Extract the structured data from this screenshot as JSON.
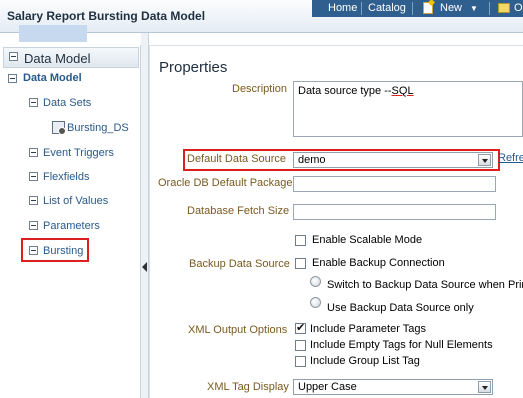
{
  "app": {
    "title": "Salary Report Bursting Data Model"
  },
  "nav": {
    "home": "Home",
    "catalog": "Catalog",
    "new": "New",
    "next_cut": "O"
  },
  "left_panel": {
    "header": "Data Model",
    "items": {
      "data_model": "Data Model",
      "data_sets": "Data Sets",
      "bursting_ds": "Bursting_DS",
      "event_triggers": "Event Triggers",
      "flexfields": "Flexfields",
      "list_of_values": "List of Values",
      "parameters": "Parameters",
      "bursting": "Bursting"
    }
  },
  "properties": {
    "title": "Properties",
    "description_label": "Description",
    "description_value_prefix": "Data source type --",
    "description_value_sql": "SQL",
    "default_data_source_label": "Default Data Source",
    "default_data_source_value": "demo",
    "refresh_link": "Refre",
    "oracle_db_default_package_label": "Oracle DB Default Package",
    "oracle_db_default_package_value": "",
    "database_fetch_size_label": "Database Fetch Size",
    "database_fetch_size_value": "",
    "enable_scalable_mode": {
      "label": "Enable Scalable Mode",
      "checked": false
    },
    "backup_data_source_label": "Backup Data Source",
    "enable_backup_connection": {
      "label": "Enable Backup Connection",
      "checked": false
    },
    "switch_backup_option": "Switch to Backup Data Source when Prim",
    "use_backup_only_option": "Use Backup Data Source only",
    "xml_output_options_label": "XML Output Options",
    "include_parameter_tags": {
      "label": "Include Parameter Tags",
      "checked": true
    },
    "include_empty_tags": {
      "label": "Include Empty Tags for Null Elements",
      "checked": false
    },
    "include_group_list_tag": {
      "label": "Include Group List Tag",
      "checked": false
    },
    "xml_tag_display_label": "XML Tag Display",
    "xml_tag_display_value": "Upper Case"
  },
  "colors": {
    "highlight": "#dd1f1f",
    "label": "#7a5a1f",
    "nav_bar": "#2f5f8f"
  }
}
